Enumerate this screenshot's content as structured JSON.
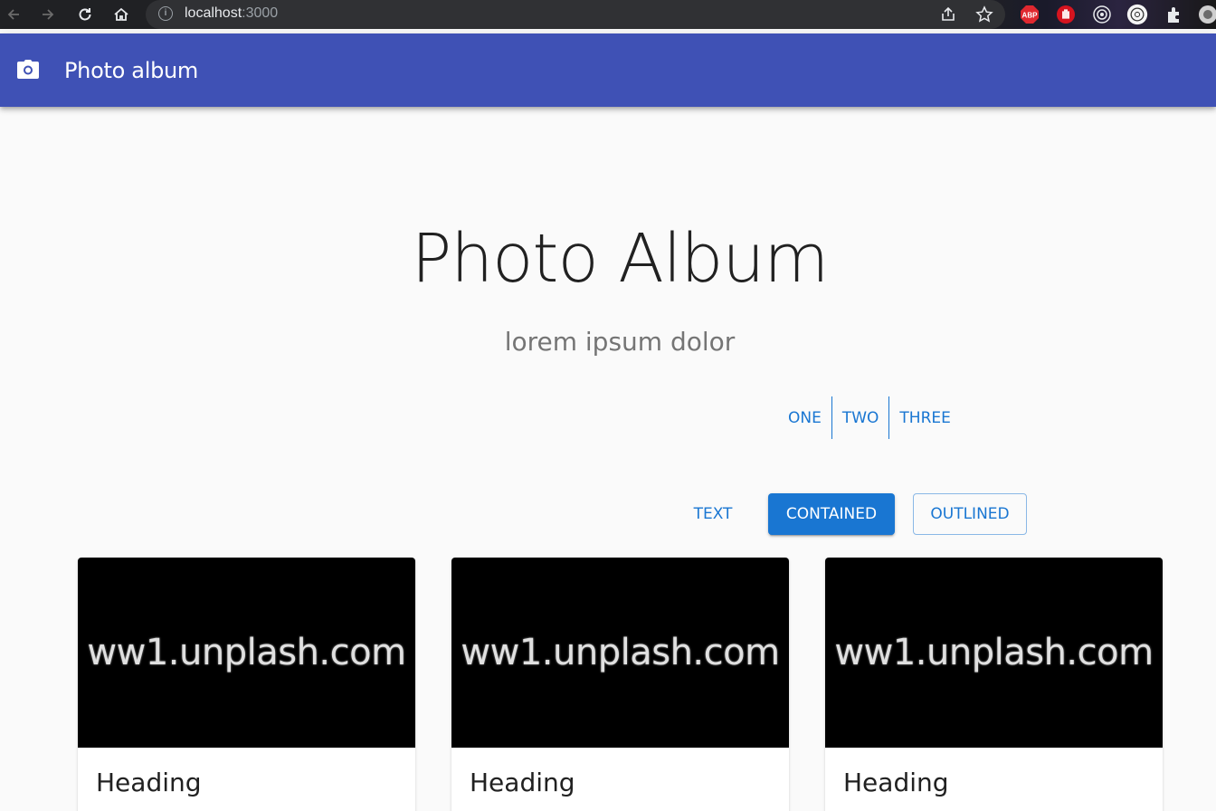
{
  "browser": {
    "url_host": "localhost",
    "url_port": ":3000",
    "icons": [
      "back-icon",
      "forward-icon",
      "reload-icon",
      "home-icon",
      "info-icon",
      "share-icon",
      "star-icon",
      "adblock-icon",
      "hand-icon",
      "target-icon",
      "circle-icon",
      "extensions-icon"
    ],
    "abp_label": "ABP"
  },
  "appbar": {
    "title": "Photo album",
    "icon": "camera-icon",
    "color": "#3f51b5"
  },
  "hero": {
    "title": "Photo Album",
    "subtitle": "lorem ipsum dolor"
  },
  "button_group": {
    "items": [
      "ONE",
      "TWO",
      "THREE"
    ]
  },
  "buttons": {
    "text": "TEXT",
    "contained": "CONTAINED",
    "outlined": "OUTLINED",
    "accent": "#1976d2"
  },
  "cards": [
    {
      "image_text": "ww1.unplash.com",
      "heading": "Heading"
    },
    {
      "image_text": "ww1.unplash.com",
      "heading": "Heading"
    },
    {
      "image_text": "ww1.unplash.com",
      "heading": "Heading"
    }
  ]
}
